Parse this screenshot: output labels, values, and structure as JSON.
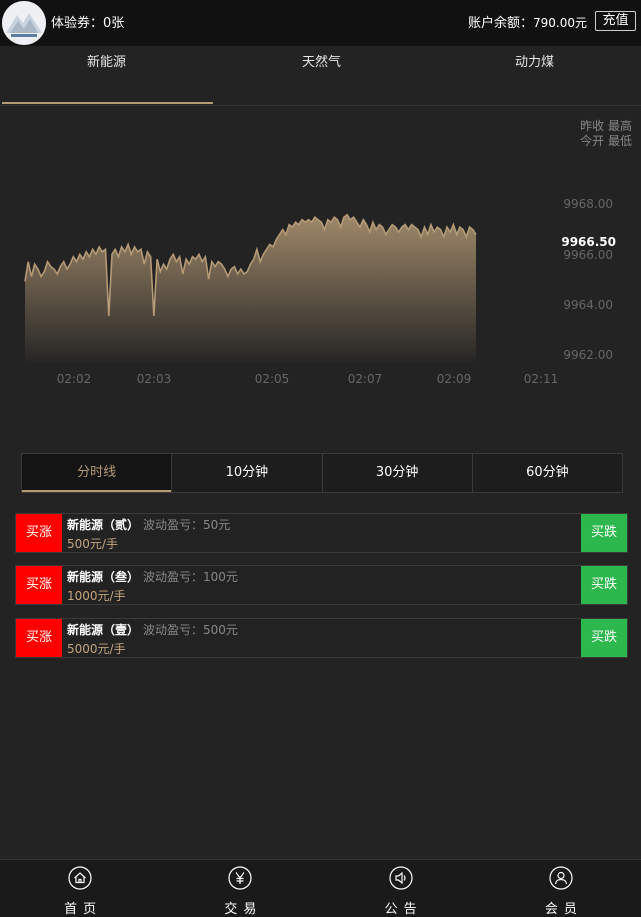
{
  "header": {
    "voucher_text": "体验券：0张",
    "balance_label": "账户余额：",
    "balance_value": "790.00元",
    "recharge_label": "充值"
  },
  "tabs": [
    {
      "label": "新能源",
      "active": true
    },
    {
      "label": "天然气",
      "active": false
    },
    {
      "label": "动力煤",
      "active": false
    }
  ],
  "quote": {
    "line1": "昨收 最高",
    "line2": "今开 最低"
  },
  "chart_data": {
    "type": "area",
    "x_tick_labels": [
      "02:02",
      "02:03",
      "02:05",
      "02:07",
      "02:09",
      "02:11"
    ],
    "y_tick_labels": [
      "9968.00",
      "9966.00",
      "9964.00",
      "9962.00"
    ],
    "current_price": "9966.50",
    "ylim": [
      9962,
      9968.6
    ],
    "series": [
      {
        "values": [
          9965.1,
          9965.9,
          9965.3,
          9965.8,
          9965.6,
          9965.3,
          9965.5,
          9965.9,
          9965.7,
          9965.6,
          9965.4,
          9965.7,
          9965.9,
          9965.6,
          9965.8,
          9966.1,
          9965.9,
          9966.2,
          9966.0,
          9966.3,
          9966.1,
          9966.4,
          9966.2,
          9966.5,
          9966.3,
          9966.4,
          9963.7,
          9966.2,
          9966.4,
          9966.1,
          9966.5,
          9966.3,
          9966.6,
          9966.2,
          9966.5,
          9966.3,
          9966.4,
          9965.8,
          9966.3,
          9966.1,
          9963.7,
          9966.0,
          9965.5,
          9965.8,
          9965.6,
          9966.0,
          9966.2,
          9965.9,
          9966.1,
          9965.4,
          9966.0,
          9965.8,
          9966.1,
          9966.0,
          9966.2,
          9965.9,
          9966.1,
          9965.2,
          9965.9,
          9965.7,
          9965.9,
          9965.8,
          9965.6,
          9965.3,
          9965.6,
          9965.7,
          9965.4,
          9965.6,
          9965.4,
          9965.5,
          9965.8,
          9966.0,
          9966.4,
          9965.9,
          9966.2,
          9966.4,
          9966.6,
          9966.5,
          9966.8,
          9967.0,
          9967.2,
          9967.0,
          9967.4,
          9967.3,
          9967.5,
          9967.4,
          9967.6,
          9967.5,
          9967.6,
          9967.5,
          9967.7,
          9967.6,
          9967.5,
          9967.2,
          9967.6,
          9967.5,
          9967.7,
          9967.6,
          9967.3,
          9967.7,
          9967.8,
          9967.6,
          9967.7,
          9967.5,
          9967.3,
          9967.6,
          9967.4,
          9967.1,
          9967.5,
          9967.2,
          9967.4,
          9967.3,
          9967.0,
          9967.2,
          9967.4,
          9967.3,
          9967.1,
          9967.3,
          9967.4,
          9967.2,
          9967.4,
          9967.3,
          9967.2,
          9966.9,
          9967.3,
          9967.0,
          9967.4,
          9967.1,
          9967.3,
          9967.2,
          9966.9,
          9967.3,
          9967.1,
          9967.4,
          9967.0,
          9967.3,
          9967.2,
          9966.9,
          9967.3,
          9967.2,
          9967.0
        ]
      }
    ],
    "line_color": "#b59a76"
  },
  "periods": [
    {
      "label": "分时线",
      "active": true
    },
    {
      "label": "10分钟",
      "active": false
    },
    {
      "label": "30分钟",
      "active": false
    },
    {
      "label": "60分钟",
      "active": false
    }
  ],
  "products": [
    {
      "buy_up": "买涨",
      "name": "新能源（贰）",
      "desc": "波动盈亏：50元",
      "price": "500元/手",
      "buy_down": "买跌"
    },
    {
      "buy_up": "买涨",
      "name": "新能源（叁）",
      "desc": "波动盈亏：100元",
      "price": "1000元/手",
      "buy_down": "买跌"
    },
    {
      "buy_up": "买涨",
      "name": "新能源（壹）",
      "desc": "波动盈亏：500元",
      "price": "5000元/手",
      "buy_down": "买跌"
    }
  ],
  "nav": [
    {
      "label": "首页",
      "icon": "home-icon"
    },
    {
      "label": "交易",
      "icon": "yen-icon"
    },
    {
      "label": "公告",
      "icon": "speaker-icon"
    },
    {
      "label": "会员",
      "icon": "user-icon"
    }
  ],
  "colors": {
    "accent": "#b59a76",
    "buy_up": "#ff0000",
    "buy_down": "#2db84d",
    "background": "#232323"
  }
}
